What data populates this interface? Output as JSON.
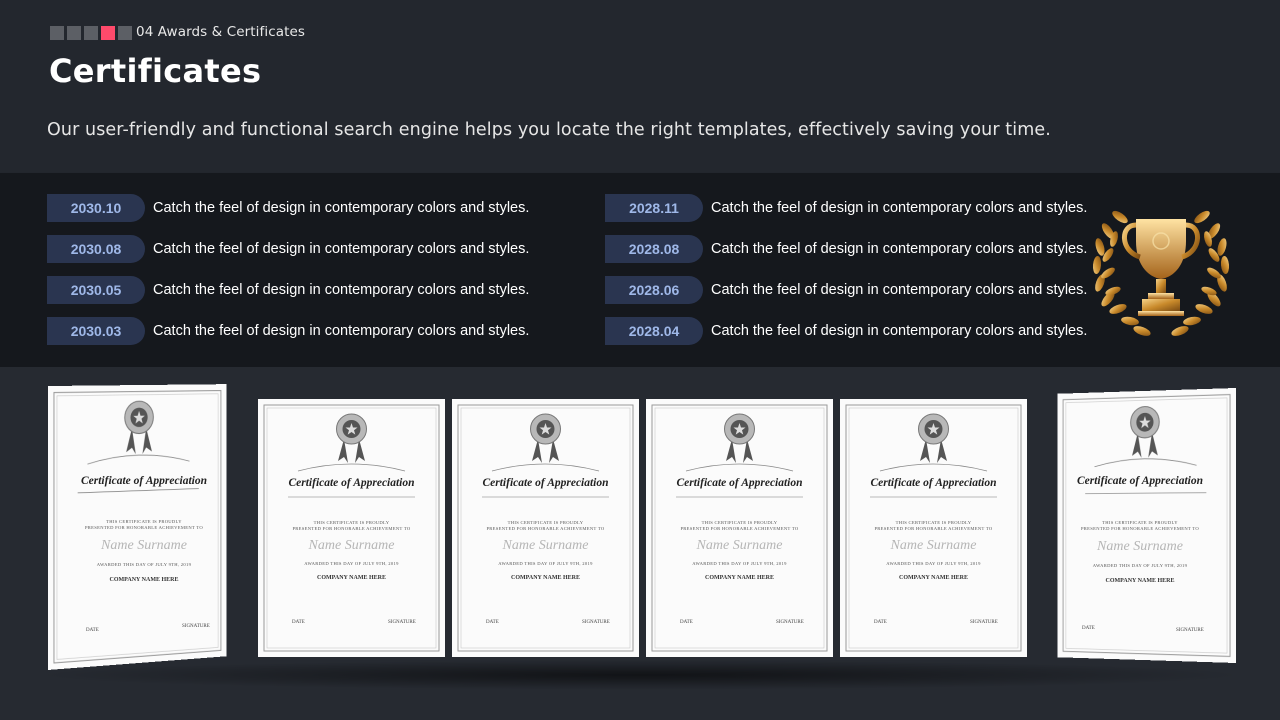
{
  "header": {
    "section_label": "04 Awards & Certificates",
    "title": "Certificates",
    "subtitle": "Our user-friendly and functional search engine helps you locate the right templates, effectively  saving your time."
  },
  "timeline_left": [
    {
      "date": "2030.10",
      "text": "Catch the feel of design in contemporary colors and styles."
    },
    {
      "date": "2030.08",
      "text": "Catch the feel of design in contemporary colors and styles."
    },
    {
      "date": "2030.05",
      "text": "Catch the feel of design in contemporary colors and styles."
    },
    {
      "date": "2030.03",
      "text": "Catch the feel of design in contemporary colors and styles."
    }
  ],
  "timeline_right": [
    {
      "date": "2028.11",
      "text": "Catch the feel of design in contemporary colors and styles."
    },
    {
      "date": "2028.08",
      "text": "Catch the feel of design in contemporary colors and styles."
    },
    {
      "date": "2028.06",
      "text": "Catch the feel of design in contemporary colors and styles."
    },
    {
      "date": "2028.04",
      "text": "Catch the feel of design in contemporary colors and styles."
    }
  ],
  "certificate": {
    "heading": "Certificate of Appreciation",
    "line1": "THIS CERTIFICATE IS PROUDLY",
    "line2": "PRESENTED FOR HONORABLE ACHIEVEMENT TO",
    "name": "Name Surname",
    "awarded": "AWARDED THIS DAY OF JULY 9TH, 2019",
    "company": "COMPANY NAME HERE",
    "date_label": "DATE",
    "signature_label": "SIGNATURE"
  },
  "colors": {
    "accent_square": "#ff4a6b",
    "date_pill_bg": "#2a3550",
    "date_pill_text": "#9fb8e8",
    "band_bg": "#15181d"
  },
  "icons": {
    "trophy": "trophy-laurel-icon",
    "seal": "award-seal-icon"
  }
}
